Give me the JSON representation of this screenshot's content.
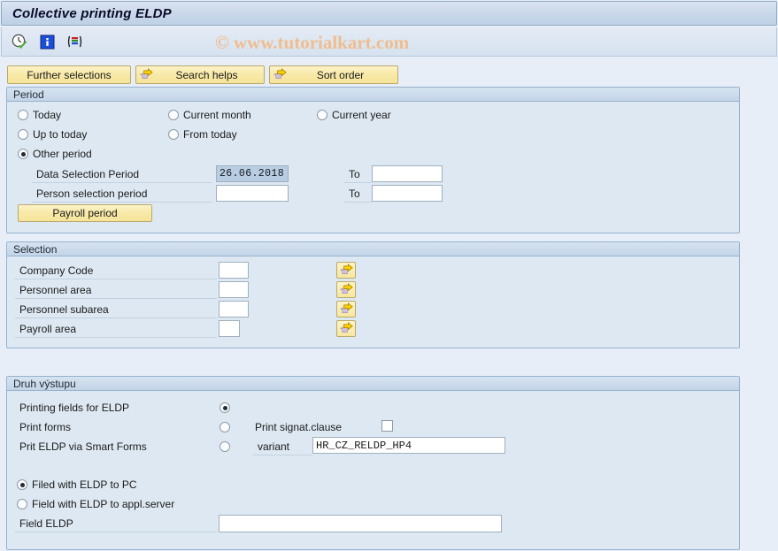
{
  "window": {
    "title": "Collective printing ELDP"
  },
  "toolbar": {
    "items": [
      {
        "name": "execute-with-variant-icon",
        "tip": "Execute"
      },
      {
        "name": "information-icon",
        "tip": "Information"
      },
      {
        "name": "multiple-selection-icon",
        "tip": "Multiple selection"
      }
    ]
  },
  "watermark": "© www.tutorialkart.com",
  "action_buttons": [
    {
      "label": "Further selections",
      "icon": false
    },
    {
      "label": "Search helps",
      "icon": true
    },
    {
      "label": "Sort order",
      "icon": true
    }
  ],
  "period": {
    "title": "Period",
    "options": [
      {
        "label": "Today",
        "selected": false
      },
      {
        "label": "Current month",
        "selected": false
      },
      {
        "label": "Current year",
        "selected": false
      },
      {
        "label": "Up to today",
        "selected": false
      },
      {
        "label": "From today",
        "selected": false
      },
      {
        "label": "Other period",
        "selected": true
      }
    ],
    "rows": [
      {
        "label": "Data Selection Period",
        "value": "26.06.2018",
        "to_label": "To",
        "to_value": ""
      },
      {
        "label": "Person selection period",
        "value": "",
        "to_label": "To",
        "to_value": ""
      }
    ],
    "payroll_period_button": "Payroll period"
  },
  "selection": {
    "title": "Selection",
    "fields": [
      {
        "label": "Company Code",
        "value": ""
      },
      {
        "label": "Personnel area",
        "value": ""
      },
      {
        "label": "Personnel subarea",
        "value": ""
      },
      {
        "label": "Payroll area",
        "value": ""
      }
    ]
  },
  "output": {
    "title": "Druh výstupu",
    "modes": [
      {
        "label": "Printing fields for ELDP",
        "selected": true
      },
      {
        "label": "Print forms",
        "selected": false
      },
      {
        "label": "Prit ELDP via Smart Forms",
        "selected": false
      }
    ],
    "print_signature_clause": {
      "label": "Print signat.clause",
      "checked": false
    },
    "variant": {
      "label": "variant",
      "value": "HR_CZ_RELDP_HP4"
    },
    "targets": [
      {
        "label": "Filed with ELDP to PC",
        "selected": true
      },
      {
        "label": "Field with ELDP to appl.server",
        "selected": false
      }
    ],
    "file_field": {
      "label": "Field ELDP",
      "value": ""
    }
  },
  "colors": {
    "page_bg": "#e8eef7",
    "group_bg": "#dde8f2",
    "group_border": "#97b3ce",
    "button_yellow": "#f8e9a8",
    "accent_arrow": "#f5c400",
    "watermark": "#f0bd8e",
    "selection_highlight": "#b9cde2"
  }
}
